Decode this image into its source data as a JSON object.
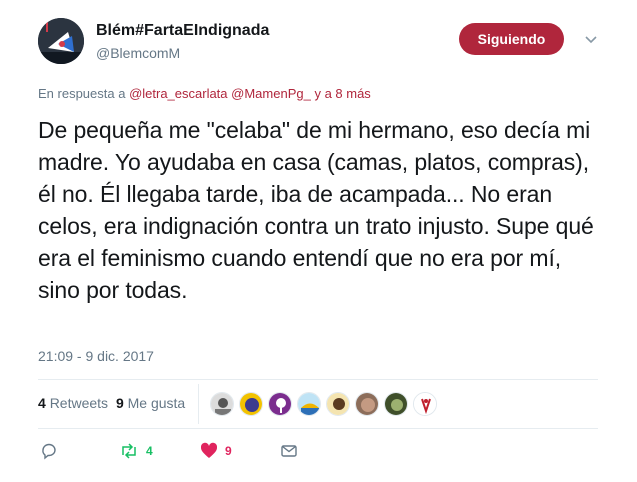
{
  "user": {
    "display_name": "Blém#FartaEIndignada",
    "handle": "@BlemcomM",
    "follow_label": "Siguiendo"
  },
  "reply": {
    "prefix": "En respuesta a ",
    "mention_1": "@letra_escarlata",
    "mention_2": "@MamenPg_",
    "suffix": " y a 8 más"
  },
  "tweet": {
    "text": "De pequeña me \"celaba\" de mi hermano, eso decía mi madre. Yo ayudaba en casa (camas, platos, compras), él no. Él llegaba tarde, iba de acampada... No eran celos, era indignación contra un trato injusto. Supe qué era el feminismo cuando entendí que no era por mí, sino por todas.",
    "timestamp": "21:09 - 9 dic. 2017"
  },
  "stats": {
    "retweets_count": "4",
    "retweets_label": "Retweets",
    "likes_count": "9",
    "likes_label": "Me gusta"
  },
  "actions": {
    "retweet_count": "4",
    "like_count": "9"
  },
  "colors": {
    "accent": "#b0263c",
    "retweet": "#17bf63",
    "like": "#e0245e",
    "muted": "#657786"
  },
  "icons": [
    "reply-icon",
    "retweet-icon",
    "heart-icon",
    "message-icon",
    "chevron-down-icon"
  ]
}
